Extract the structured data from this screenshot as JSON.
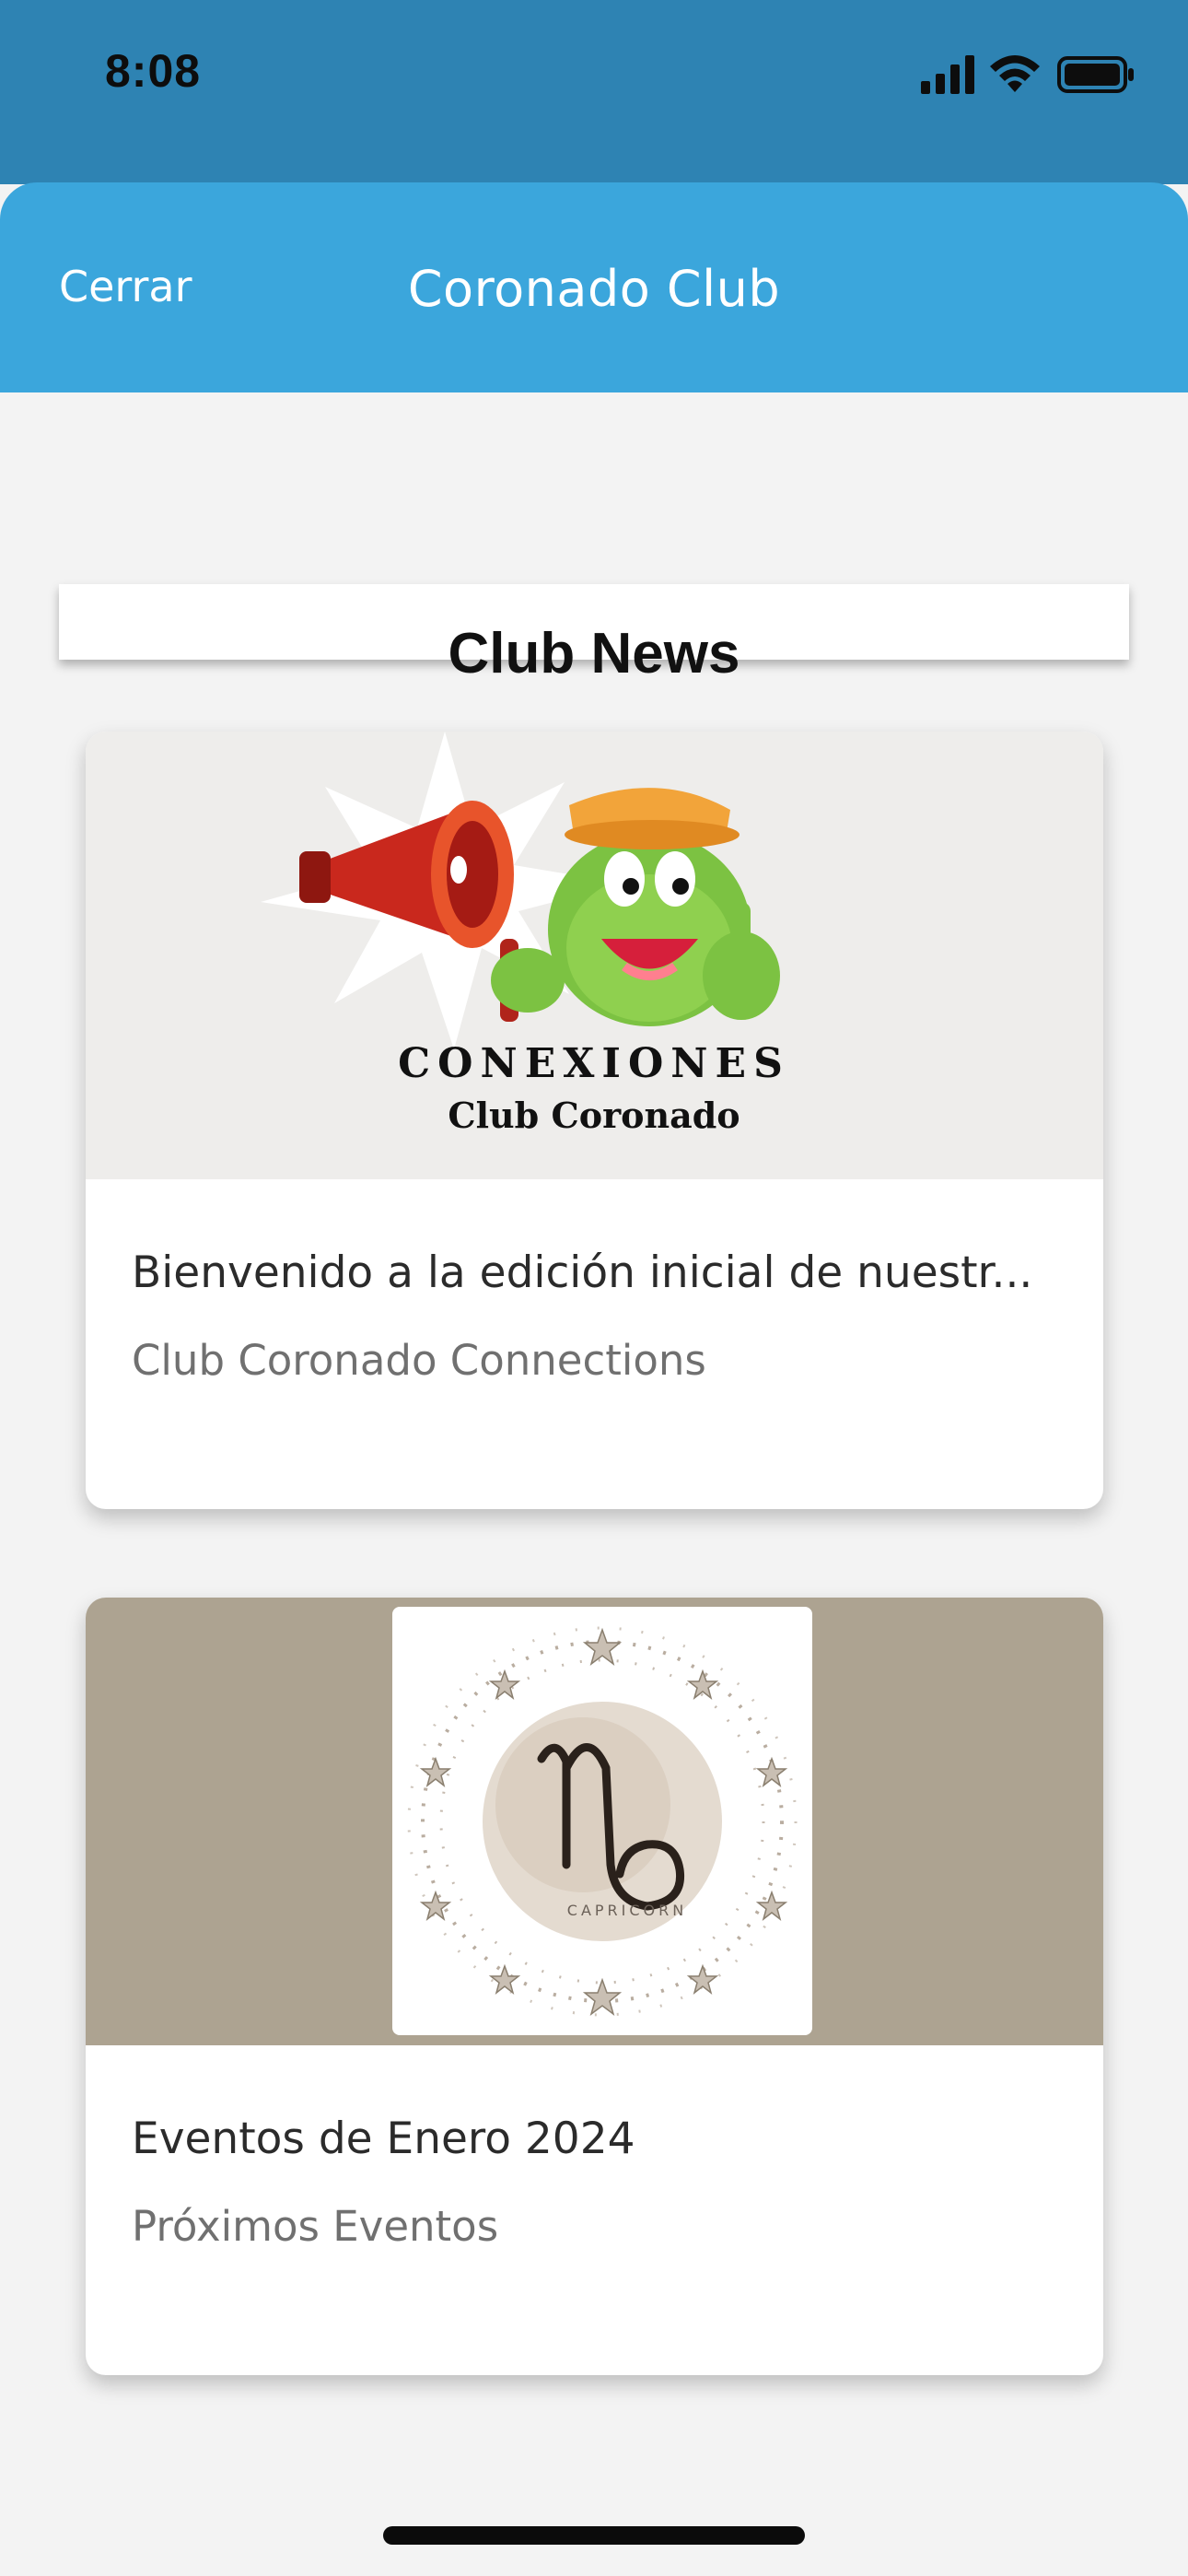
{
  "status_bar": {
    "time": "8:08",
    "icons": [
      "cellular-signal-icon",
      "wifi-icon",
      "battery-icon"
    ]
  },
  "header": {
    "close_label": "Cerrar",
    "title": "Coronado Club",
    "background_color": "#3ba6dc"
  },
  "section": {
    "title": "Club News"
  },
  "news": [
    {
      "image": {
        "name": "conexiones-logo",
        "line1": "CONEXIONES",
        "line2": "Club Coronado",
        "background_color": "#eeedeb"
      },
      "title": "Bienvenido a la edición inicial de nuestr...",
      "subtitle": "Club Coronado Connections"
    },
    {
      "image": {
        "name": "capricorn-illustration",
        "caption": "CAPRICORN",
        "background_color": "#ada391"
      },
      "title": "Eventos de Enero 2024",
      "subtitle": "Próximos Eventos"
    }
  ]
}
